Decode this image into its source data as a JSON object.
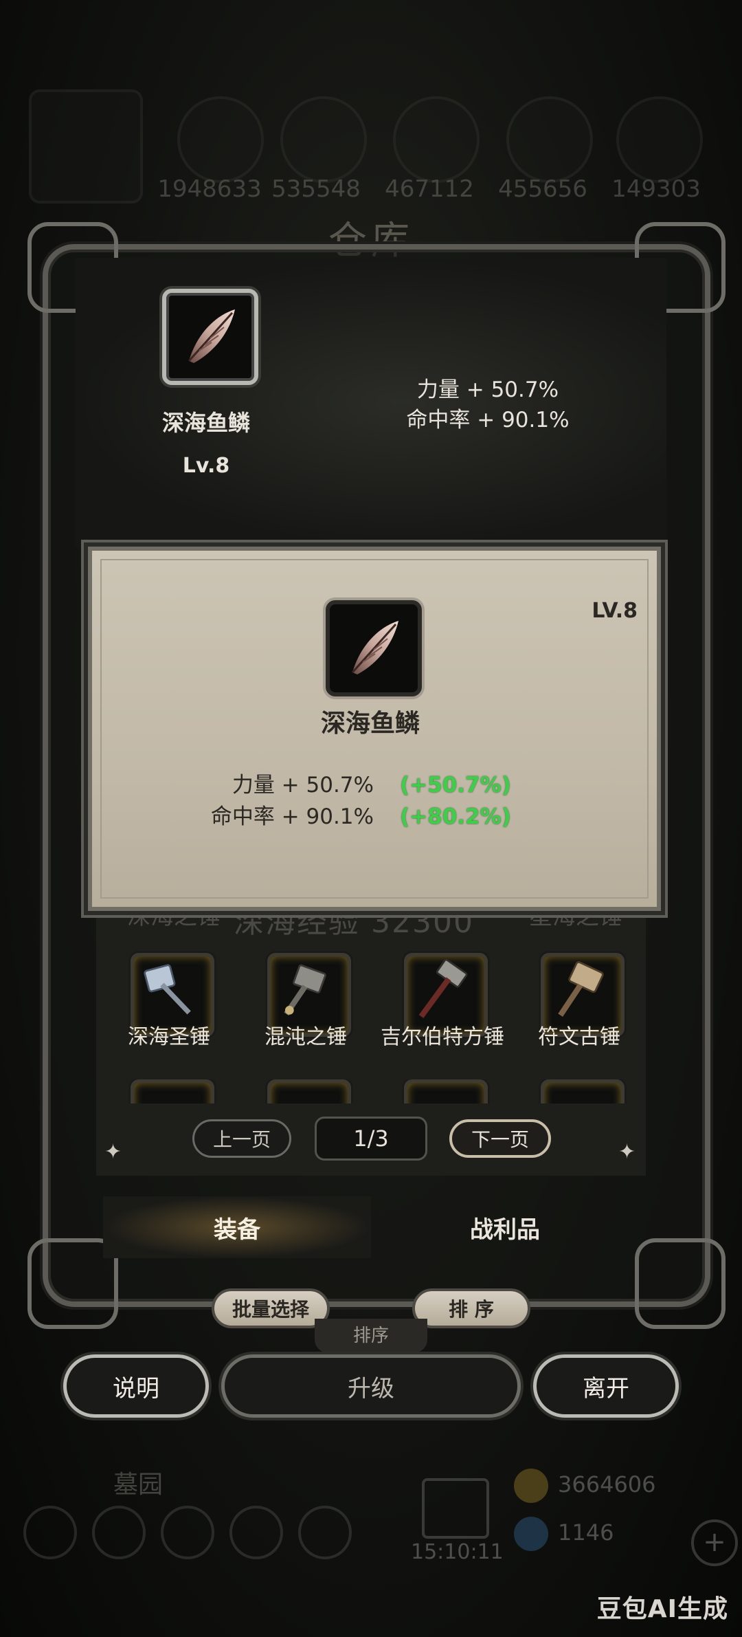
{
  "top_bar": {
    "values": [
      "1948633",
      "535548",
      "467112",
      "455656",
      "149303"
    ]
  },
  "title": "仓库",
  "selected_item": {
    "name": "深海鱼鳞",
    "level": "Lv.8",
    "stats": [
      "力量 + 50.7%",
      "命中率 + 90.1%"
    ],
    "icon": "feather-scale-icon"
  },
  "popup": {
    "level": "LV.8",
    "name": "深海鱼鳞",
    "stats": [
      {
        "label": "力量 + 50.7%",
        "bonus": "(+50.7%)"
      },
      {
        "label": "命中率 + 90.1%",
        "bonus": "(+80.2%)"
      }
    ],
    "bonus_color": "#3fce49"
  },
  "grid": {
    "faded_left": "深海之锤",
    "exp_text": "深海经验 32300",
    "faded_right": "星海之锤",
    "items": [
      {
        "label": "深海圣锤",
        "icon": "silver-hammer-icon"
      },
      {
        "label": "混沌之锤",
        "icon": "iron-hammer-icon"
      },
      {
        "label": "吉尔伯特方锤",
        "icon": "war-hammer-icon"
      },
      {
        "label": "符文古锤",
        "icon": "rune-hammer-icon"
      }
    ]
  },
  "pagination": {
    "prev": "上一页",
    "page": "1/3",
    "next": "下一页"
  },
  "tabs": [
    "装备",
    "战利品"
  ],
  "actions": {
    "batch_select": "批量选择",
    "sort": "排 序",
    "sort_sub": "排序"
  },
  "buttons": {
    "info": "说明",
    "upgrade": "升级",
    "leave": "离开"
  },
  "bottom_bar": {
    "location": "墓园",
    "time": "15:10:11",
    "gold": "3664606",
    "gems": "1146"
  },
  "watermark": "豆包AI生成"
}
